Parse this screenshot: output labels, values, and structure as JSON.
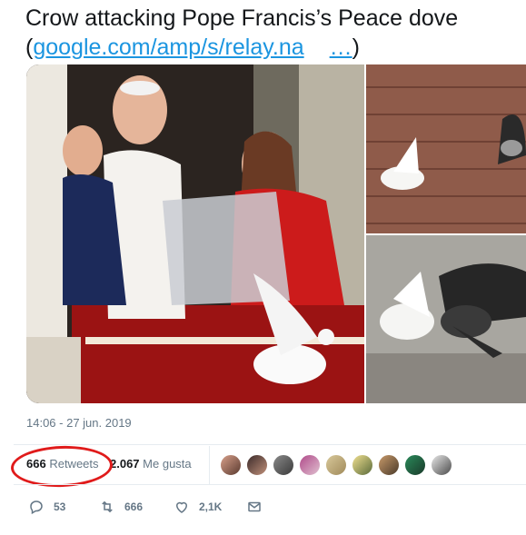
{
  "tweet": {
    "text": "Crow attacking Pope Francis’s Peace dove",
    "paren_open": "(",
    "link_text": "google.com/amp/s/relay.na",
    "ellipsis": "…",
    "paren_close": ")"
  },
  "timestamp": "14:06 - 27 jun. 2019",
  "stats": {
    "retweets_count": "666",
    "retweets_label": "Retweets",
    "likes_count": "2.067",
    "likes_label": "Me gusta"
  },
  "actions": {
    "reply_count": "53",
    "retweet_count": "666",
    "like_count": "2,1K"
  },
  "colors": {
    "link": "#1b95e0",
    "annotation": "#e01b1b",
    "muted": "#657786"
  },
  "icons": [
    "reply-icon",
    "retweet-icon",
    "heart-icon",
    "message-icon"
  ]
}
